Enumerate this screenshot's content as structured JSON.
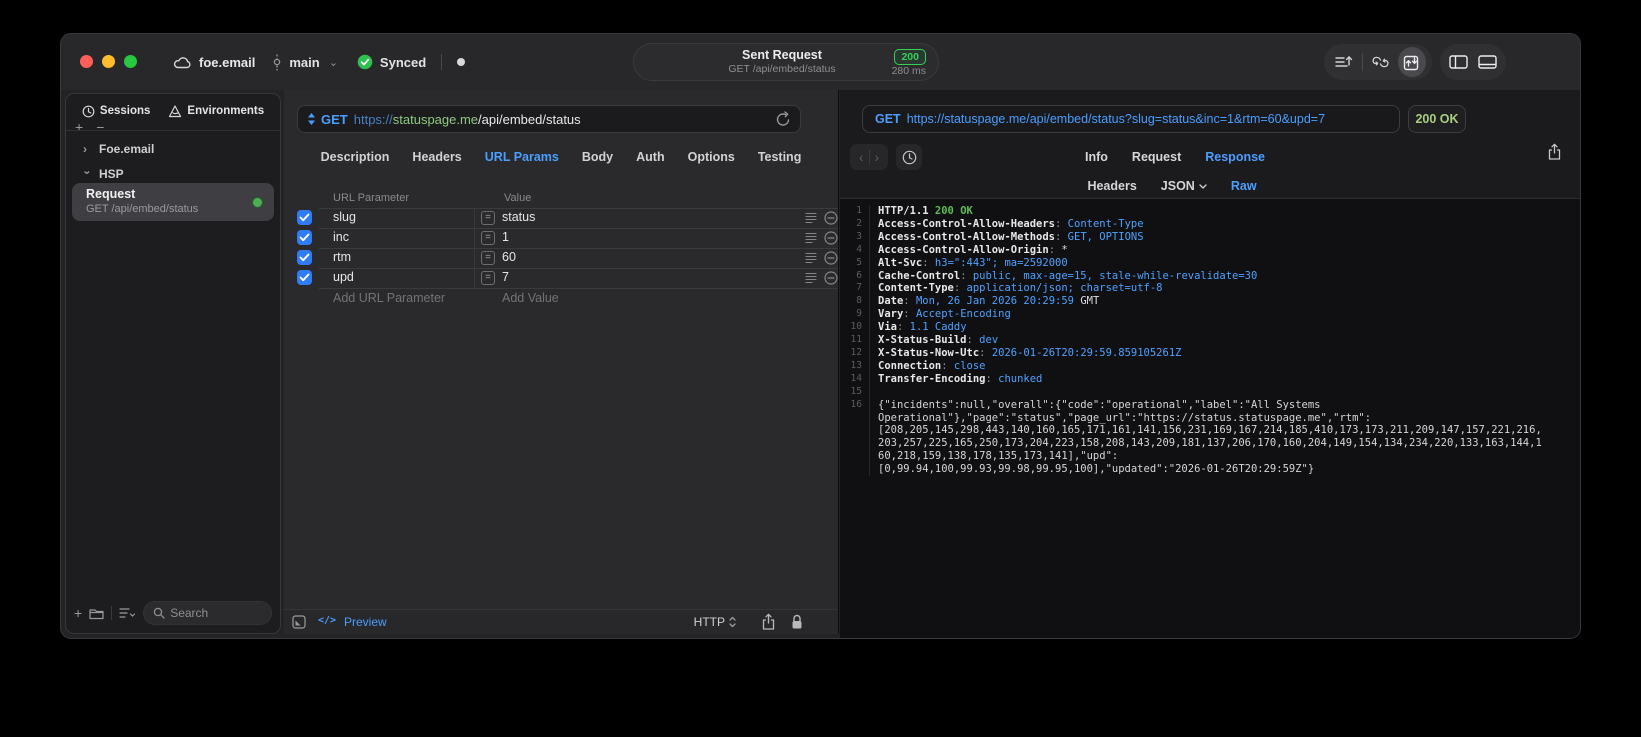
{
  "titlebar": {
    "project": "foe.email",
    "branch": "main",
    "sync_status": "Synced",
    "request_title": "Sent Request",
    "request_subtitle": "GET /api/embed/status",
    "status_code": "200",
    "duration": "280 ms"
  },
  "sidebar": {
    "tabs": [
      {
        "label": "Sessions"
      },
      {
        "label": "Environments"
      }
    ],
    "tree": [
      {
        "label": "Foe.email",
        "expanded": false
      },
      {
        "label": "HSP",
        "expanded": true
      }
    ],
    "request_item": {
      "title": "Request",
      "subtitle": "GET /api/embed/status"
    },
    "search_placeholder": "Search"
  },
  "request_pane": {
    "method": "GET",
    "url_scheme": "https://",
    "url_host": "statuspage.me",
    "url_path": "/api/embed/status",
    "tabs": [
      "Description",
      "Headers",
      "URL Params",
      "Body",
      "Auth",
      "Options",
      "Testing"
    ],
    "active_tab": "URL Params",
    "table": {
      "columns": [
        "URL Parameter",
        "Value"
      ],
      "rows": [
        {
          "checked": true,
          "name": "slug",
          "value": "status"
        },
        {
          "checked": true,
          "name": "inc",
          "value": "1"
        },
        {
          "checked": true,
          "name": "rtm",
          "value": "60"
        },
        {
          "checked": true,
          "name": "upd",
          "value": "7"
        }
      ],
      "add_name_placeholder": "Add URL Parameter",
      "add_value_placeholder": "Add Value"
    },
    "footer": {
      "preview_label": "Preview",
      "protocol": "HTTP"
    }
  },
  "response_pane": {
    "method": "GET",
    "url": "https://statuspage.me/api/embed/status?slug=status&inc=1&rtm=60&upd=7",
    "status": "200 OK",
    "tabs": [
      "Info",
      "Request",
      "Response"
    ],
    "active_tab": "Response",
    "subtabs": [
      "Headers",
      "JSON",
      "Raw"
    ],
    "active_subtab": "Raw",
    "http_lines": [
      {
        "num": "1",
        "segs": [
          [
            "HTTP/1.1 ",
            "n"
          ],
          [
            "200 OK",
            "g"
          ]
        ]
      },
      {
        "num": "2",
        "segs": [
          [
            "Access-Control-Allow-Headers",
            "n"
          ],
          [
            ": ",
            "c"
          ],
          [
            "Content-Type",
            "b"
          ]
        ]
      },
      {
        "num": "3",
        "segs": [
          [
            "Access-Control-Allow-Methods",
            "n"
          ],
          [
            ": ",
            "c"
          ],
          [
            "GET, OPTIONS",
            "b"
          ]
        ]
      },
      {
        "num": "4",
        "segs": [
          [
            "Access-Control-Allow-Origin",
            "n"
          ],
          [
            ": ",
            "c"
          ],
          [
            "*",
            "w"
          ]
        ]
      },
      {
        "num": "5",
        "segs": [
          [
            "Alt-Svc",
            "n"
          ],
          [
            ": ",
            "c"
          ],
          [
            "h3=\":443\"; ma=2592000",
            "b"
          ]
        ]
      },
      {
        "num": "6",
        "segs": [
          [
            "Cache-Control",
            "n"
          ],
          [
            ": ",
            "c"
          ],
          [
            "public, max-age=15, stale-while-revalidate=30",
            "b"
          ]
        ]
      },
      {
        "num": "7",
        "segs": [
          [
            "Content-Type",
            "n"
          ],
          [
            ": ",
            "c"
          ],
          [
            "application/json; charset=utf-8",
            "b"
          ]
        ]
      },
      {
        "num": "8",
        "segs": [
          [
            "Date",
            "n"
          ],
          [
            ": ",
            "c"
          ],
          [
            "Mon, 26 Jan 2026 20:29:59",
            "b"
          ],
          [
            " GMT",
            "w"
          ]
        ]
      },
      {
        "num": "9",
        "segs": [
          [
            "Vary",
            "n"
          ],
          [
            ": ",
            "c"
          ],
          [
            "Accept-Encoding",
            "b"
          ]
        ]
      },
      {
        "num": "10",
        "segs": [
          [
            "Via",
            "n"
          ],
          [
            ": ",
            "c"
          ],
          [
            "1.1 Caddy",
            "b"
          ]
        ]
      },
      {
        "num": "11",
        "segs": [
          [
            "X-Status-Build",
            "n"
          ],
          [
            ": ",
            "c"
          ],
          [
            "dev",
            "b"
          ]
        ]
      },
      {
        "num": "12",
        "segs": [
          [
            "X-Status-Now-Utc",
            "n"
          ],
          [
            ": ",
            "c"
          ],
          [
            "2026-01-26T20:29:59.859105261Z",
            "b"
          ]
        ]
      },
      {
        "num": "13",
        "segs": [
          [
            "Connection",
            "n"
          ],
          [
            ": ",
            "c"
          ],
          [
            "close",
            "b"
          ]
        ]
      },
      {
        "num": "14",
        "segs": [
          [
            "Transfer-Encoding",
            "n"
          ],
          [
            ": ",
            "c"
          ],
          [
            "chunked",
            "b"
          ]
        ]
      },
      {
        "num": "15",
        "segs": []
      }
    ],
    "body_number": "16",
    "body_lines": [
      "{\"incidents\":null,\"overall\":{\"code\":\"operational\",\"label\":\"All Systems",
      "Operational\"},\"page\":\"status\",\"page_url\":\"https://status.statuspage.me\",\"rtm\":",
      "[208,205,145,298,443,140,160,165,171,161,141,156,231,169,167,214,185,410,173,173,211,209,147,157,221,216,",
      "203,257,225,165,250,173,204,223,158,208,143,209,181,137,206,170,160,204,149,154,134,234,220,133,163,144,1",
      "60,218,159,138,178,135,173,141],\"upd\":",
      "[0,99.94,100,99.93,99.98,99.95,100],\"updated\":\"2026-01-26T20:29:59Z\"}"
    ]
  },
  "colors": {
    "accent_blue": "#4a9eff",
    "value_blue": "#4da2ff",
    "status_green": "#32d158",
    "header_green": "#58bd4e",
    "url_host_green": "#8fc97f",
    "checkbox_blue": "#2f7cf6",
    "traffic_red": "#ff5f57",
    "traffic_yellow": "#febc2e",
    "traffic_green": "#28c840"
  }
}
